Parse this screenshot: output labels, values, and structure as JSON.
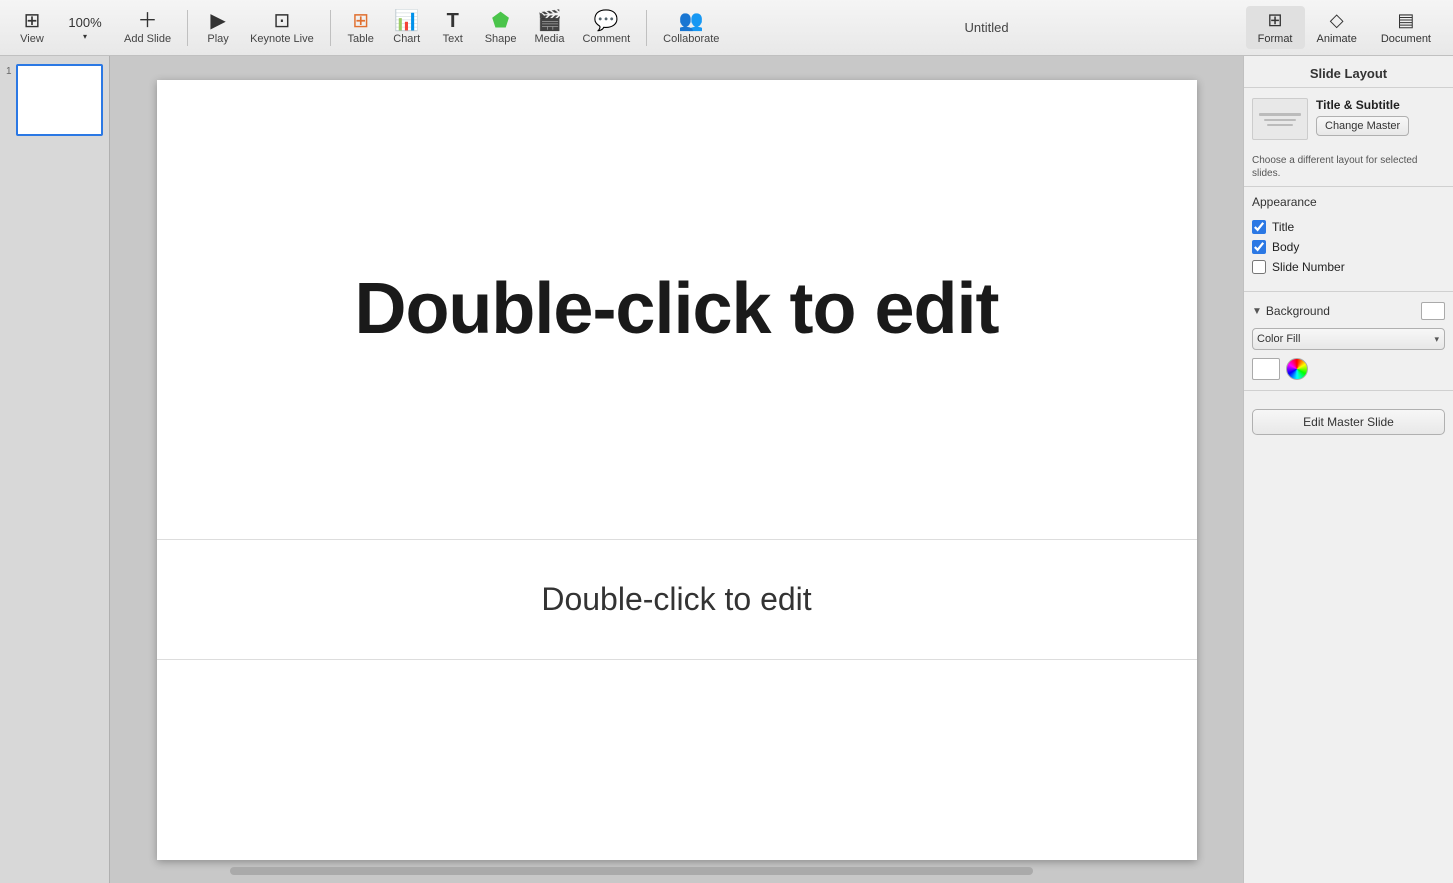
{
  "app": {
    "title": "Untitled"
  },
  "toolbar": {
    "zoom_label": "100%",
    "view_label": "View",
    "zoom_display": "100%",
    "add_slide_label": "Add Slide",
    "play_label": "Play",
    "keynote_live_label": "Keynote Live",
    "table_label": "Table",
    "chart_label": "Chart",
    "text_label": "Text",
    "shape_label": "Shape",
    "media_label": "Media",
    "comment_label": "Comment",
    "collaborate_label": "Collaborate",
    "format_label": "Format",
    "animate_label": "Animate",
    "document_label": "Document"
  },
  "slide": {
    "title_placeholder": "Double-click to edit",
    "subtitle_placeholder": "Double-click to edit",
    "number": "1"
  },
  "right_panel": {
    "title": "Slide Layout",
    "layout_name": "Title & Subtitle",
    "change_master_label": "Change Master",
    "tooltip": "Choose a different layout for selected slides.",
    "appearance_header": "Appearance",
    "title_checkbox_label": "Title",
    "body_checkbox_label": "Body",
    "slide_number_label": "Slide Number",
    "title_checked": true,
    "body_checked": true,
    "slide_number_checked": false,
    "background_header": "Background",
    "color_fill_label": "Color Fill",
    "edit_master_label": "Edit Master Slide"
  }
}
